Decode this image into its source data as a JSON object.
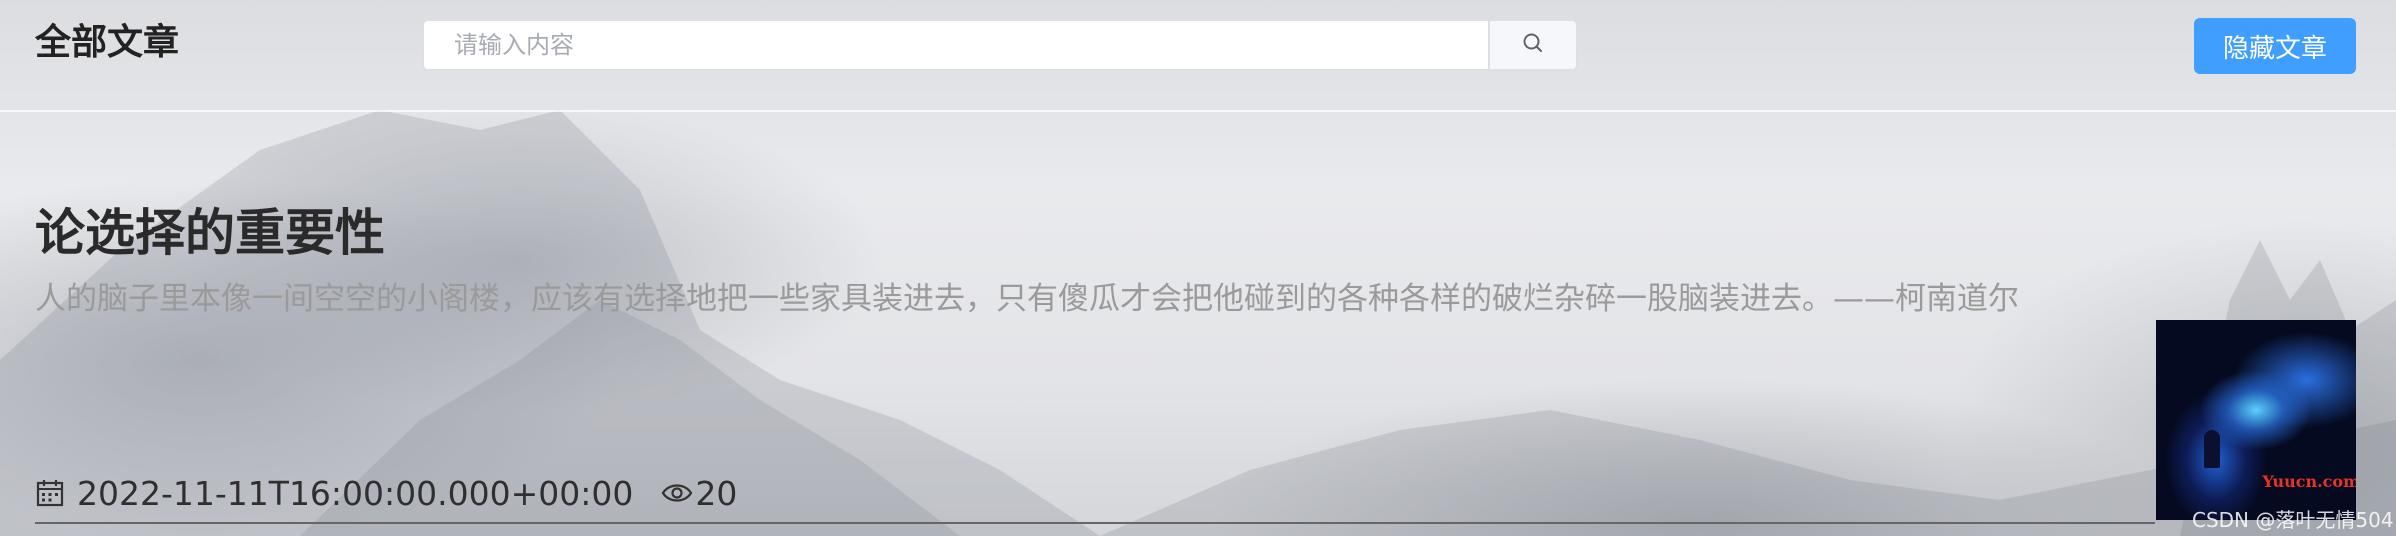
{
  "header": {
    "title": "全部文章",
    "search_placeholder": "请输入内容",
    "hide_button_label": "隐藏文章"
  },
  "article": {
    "title": "论选择的重要性",
    "summary": "人的脑子里本像一间空空的小阁楼，应该有选择地把一些家具装进去，只有傻瓜才会把他碰到的各种各样的破烂杂碎一股脑装进去。——柯南道尔",
    "date": "2022-11-11T16:00:00.000+00:00",
    "views": "20"
  },
  "thumbnail": {
    "site_mark": "Yuucn.com"
  },
  "watermark": "CSDN @落叶无情504",
  "colors": {
    "primary_button": "#409eff",
    "title_text": "#2a2a2a",
    "summary_text": "#9a9a9a"
  },
  "icons": {
    "search": "search-icon",
    "date": "calendar-icon",
    "views": "eye-icon"
  }
}
